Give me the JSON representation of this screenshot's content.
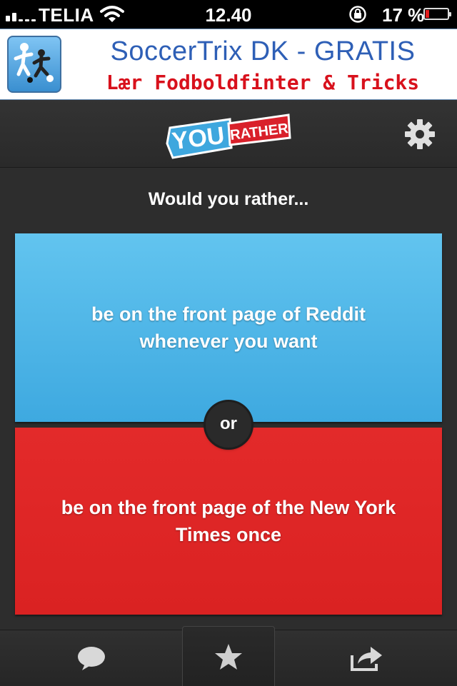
{
  "status_bar": {
    "carrier": "TELIA",
    "time": "12.40",
    "battery_percent": "17 %",
    "battery_level": 0.17
  },
  "ad": {
    "title": "SoccerTrix DK - GRATIS",
    "subtitle": "Lær Fodboldfinter & Tricks"
  },
  "header": {
    "logo_you": "YOU",
    "logo_rather": "RATHER",
    "settings_icon": "gear-icon"
  },
  "question": {
    "prompt": "Would you rather...",
    "option_a": "be on the front page of Reddit whenever you want",
    "option_b": "be on the front page of the New York Times once",
    "separator": "or"
  },
  "colors": {
    "option_a": "#4bb5e8",
    "option_b": "#de2626",
    "background": "#2d2d2d"
  },
  "tabbar": {
    "items": [
      {
        "icon": "speech-bubble-icon"
      },
      {
        "icon": "star-icon"
      },
      {
        "icon": "share-icon"
      }
    ]
  }
}
